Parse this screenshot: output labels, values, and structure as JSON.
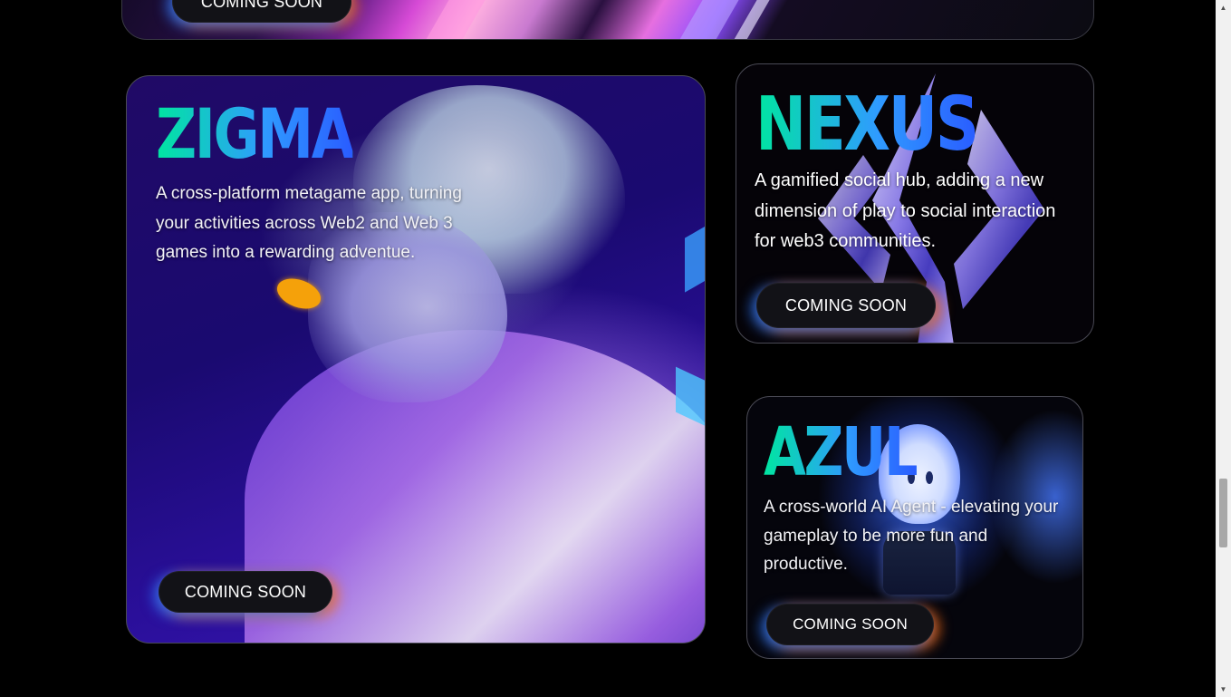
{
  "top_card": {
    "button_label": "COMING SOON"
  },
  "cards": {
    "zigma": {
      "title": "ZIGMA",
      "description": "A cross-platform metagame app, turning your activities across Web2 and Web 3 games into a rewarding adventue.",
      "button_label": "COMING SOON"
    },
    "nexus": {
      "title": "NEXUS",
      "description": "A gamified social hub, adding a new dimension of play to social interaction for web3 communities.",
      "button_label": "COMING SOON"
    },
    "azul": {
      "title": "AZUL",
      "description": "A cross-world AI Agent - elevating your gameplay to be more fun and productive.",
      "button_label": "COMING SOON"
    }
  },
  "colors": {
    "page_background": "#000000",
    "title_gradient_start": "#00e6a0",
    "title_gradient_end": "#2a5cff",
    "button_background": "#121217",
    "button_glow_left": "#2878ff",
    "button_glow_right": "#ff6e14"
  },
  "icons": {
    "scroll_up": "triangle-up-icon",
    "scroll_down": "triangle-down-icon"
  }
}
